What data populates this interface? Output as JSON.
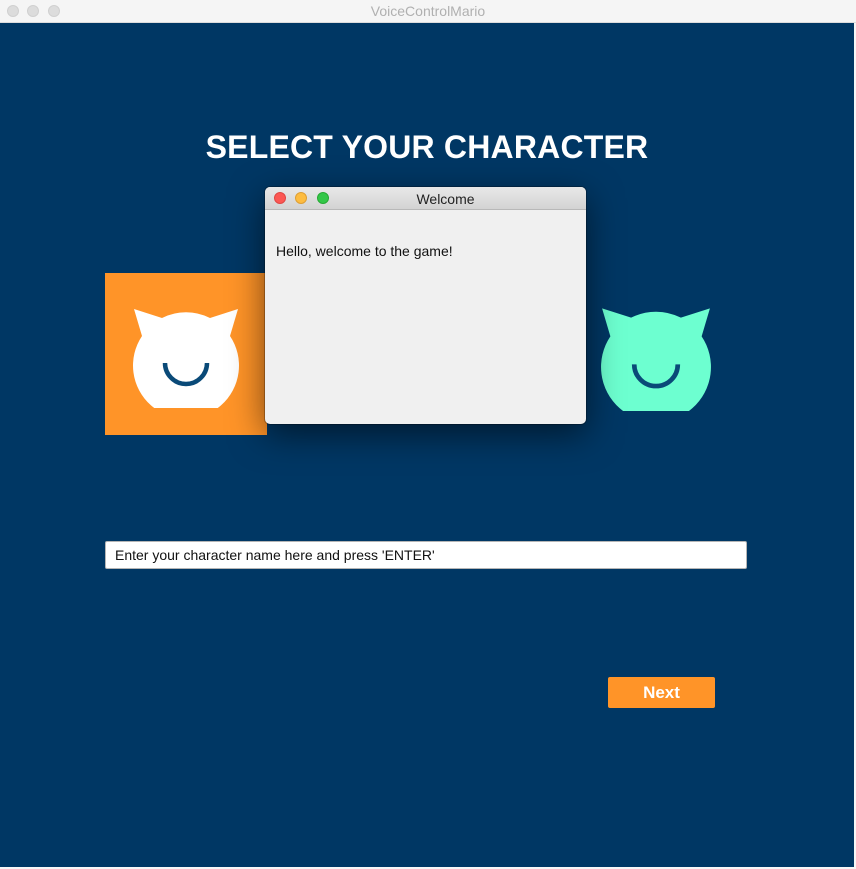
{
  "window": {
    "title": "VoiceControlMario"
  },
  "heading": "SELECT YOUR CHARACTER",
  "characters": [
    {
      "icon": "cat-face-icon",
      "card_color": "#ff9428",
      "face_color": "#ffffff",
      "selected": true
    },
    {
      "icon": "cat-face-icon",
      "card_color": "",
      "face_color": "#6dffd0",
      "selected": false
    }
  ],
  "dialog": {
    "title": "Welcome",
    "message": "Hello, welcome to the game!"
  },
  "name_input": {
    "placeholder": "Enter your character name here and press 'ENTER'",
    "value": ""
  },
  "next_button": {
    "label": "Next"
  },
  "colors": {
    "background": "#003764",
    "accent": "#ff9428",
    "teal": "#6dffd0",
    "smile": "#0a4a78"
  }
}
